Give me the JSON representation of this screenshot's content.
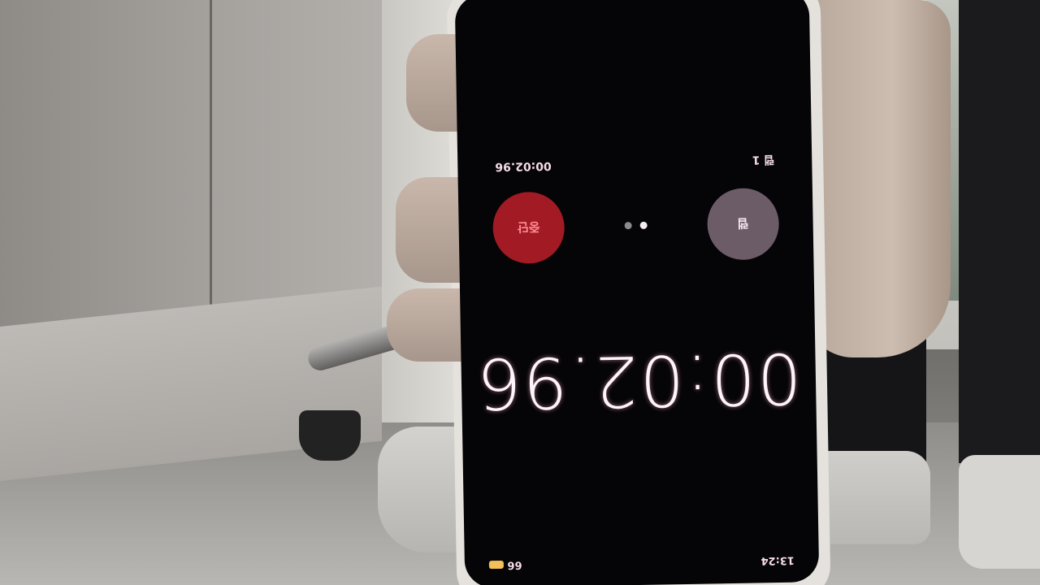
{
  "status_bar": {
    "time": "13:24",
    "battery_level": "66"
  },
  "stopwatch": {
    "elapsed": "00:02.96",
    "lap_label": "랩 1",
    "lap_time": "00:02.96",
    "left_button": "랩",
    "right_button": "중단",
    "page_indicator": {
      "count": 2,
      "active": 1
    }
  },
  "colors": {
    "stop_button": "#a11a24",
    "lap_button": "#6b5c67",
    "battery": "#f3c05a"
  }
}
